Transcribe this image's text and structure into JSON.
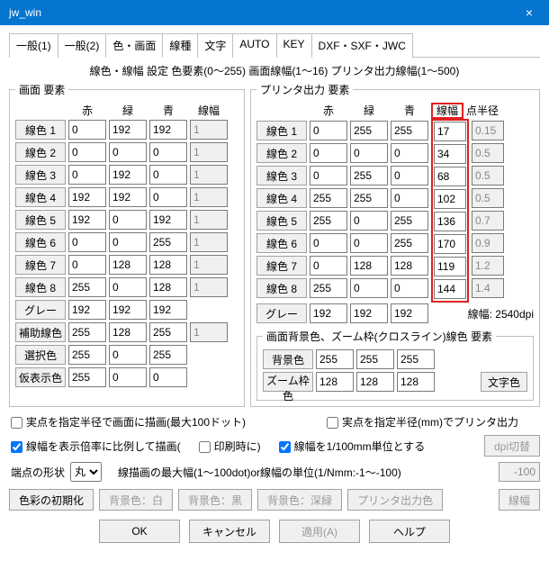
{
  "window": {
    "title": "jw_win",
    "close": "×"
  },
  "tabs": [
    "一般(1)",
    "一般(2)",
    "色・画面",
    "線種",
    "文字",
    "AUTO",
    "KEY",
    "DXF・SXF・JWC"
  ],
  "activeTab": 2,
  "subtitle": "線色・線幅 設定  色要素(0～255) 画面線幅(1～16) プリンタ出力線幅(1～500)",
  "groups": {
    "screen": {
      "legend": "画面 要素",
      "headers": [
        "赤",
        "緑",
        "青",
        "線幅"
      ],
      "rows": [
        {
          "label": "線色 1",
          "r": "0",
          "g": "192",
          "b": "192",
          "w": "1"
        },
        {
          "label": "線色 2",
          "r": "0",
          "g": "0",
          "b": "0",
          "w": "1"
        },
        {
          "label": "線色 3",
          "r": "0",
          "g": "192",
          "b": "0",
          "w": "1"
        },
        {
          "label": "線色 4",
          "r": "192",
          "g": "192",
          "b": "0",
          "w": "1"
        },
        {
          "label": "線色 5",
          "r": "192",
          "g": "0",
          "b": "192",
          "w": "1"
        },
        {
          "label": "線色 6",
          "r": "0",
          "g": "0",
          "b": "255",
          "w": "1"
        },
        {
          "label": "線色 7",
          "r": "0",
          "g": "128",
          "b": "128",
          "w": "1"
        },
        {
          "label": "線色 8",
          "r": "255",
          "g": "0",
          "b": "128",
          "w": "1"
        }
      ],
      "gray": {
        "label": "グレー",
        "r": "192",
        "g": "192",
        "b": "192"
      },
      "aux": {
        "label": "補助線色",
        "r": "255",
        "g": "128",
        "b": "255",
        "w": "1"
      },
      "sel": {
        "label": "選択色",
        "r": "255",
        "g": "0",
        "b": "255"
      },
      "temp": {
        "label": "仮表示色",
        "r": "255",
        "g": "0",
        "b": "0"
      }
    },
    "printer": {
      "legend": "プリンタ出力 要素",
      "headers": [
        "赤",
        "緑",
        "青",
        "線幅",
        "点半径"
      ],
      "rows": [
        {
          "label": "線色 1",
          "r": "0",
          "g": "255",
          "b": "255",
          "w": "17",
          "pr": "0.15"
        },
        {
          "label": "線色 2",
          "r": "0",
          "g": "0",
          "b": "0",
          "w": "34",
          "pr": "0.5"
        },
        {
          "label": "線色 3",
          "r": "0",
          "g": "255",
          "b": "0",
          "w": "68",
          "pr": "0.5"
        },
        {
          "label": "線色 4",
          "r": "255",
          "g": "255",
          "b": "0",
          "w": "102",
          "pr": "0.5"
        },
        {
          "label": "線色 5",
          "r": "255",
          "g": "0",
          "b": "255",
          "w": "136",
          "pr": "0.7"
        },
        {
          "label": "線色 6",
          "r": "0",
          "g": "0",
          "b": "255",
          "w": "170",
          "pr": "0.9"
        },
        {
          "label": "線色 7",
          "r": "0",
          "g": "128",
          "b": "128",
          "w": "119",
          "pr": "1.2"
        },
        {
          "label": "線色 8",
          "r": "255",
          "g": "0",
          "b": "0",
          "w": "144",
          "pr": "1.4"
        }
      ],
      "gray": {
        "label": "グレー",
        "r": "192",
        "g": "192",
        "b": "192"
      },
      "dpi_label": "線幅:  2540dpi",
      "bg_group": {
        "legend": "画面背景色、ズーム枠(クロスライン)線色 要素",
        "bg": {
          "label": "背景色",
          "r": "255",
          "g": "255",
          "b": "255"
        },
        "zm": {
          "label": "ズーム枠色",
          "r": "128",
          "g": "128",
          "b": "128"
        },
        "text_btn": "文字色"
      }
    }
  },
  "checks": {
    "c1": "実点を指定半径で画面に描画(最大100ドット)",
    "c2": "実点を指定半径(mm)でプリンタ出力",
    "c3": "線幅を表示倍率に比例して描画(",
    "c4": "印刷時に)",
    "c5": "線幅を1/100mm単位とする",
    "dpi_btn": "dpi切替"
  },
  "endshape": {
    "label": "端点の形状",
    "value": "丸",
    "desc": "線描画の最大幅(1～100dot)or線幅の単位(1/Nmm:-1～-100)",
    "num": "-100"
  },
  "bottom_buttons": {
    "reset": "色彩の初期化",
    "bg_white": "背景色：白",
    "bg_black": "背景色：黒",
    "bg_deep": "背景色：深緑",
    "pr_color": "プリンタ出力色",
    "lw": "線幅"
  },
  "actions": {
    "ok": "OK",
    "cancel": "キャンセル",
    "apply": "適用(A)",
    "help": "ヘルプ"
  }
}
